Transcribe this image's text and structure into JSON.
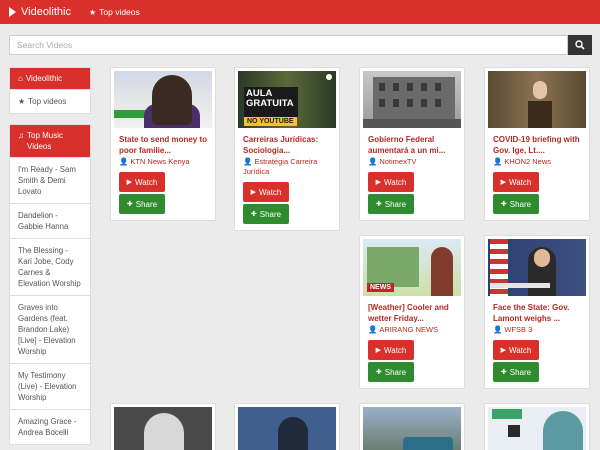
{
  "topbar": {
    "brand": "Videolithic",
    "top_videos_link": "Top videos"
  },
  "search": {
    "placeholder": "Search Videos"
  },
  "sidebar": {
    "nav_panel": {
      "home_label": "Videolithic",
      "top_videos_label": "Top videos"
    },
    "music_panel": {
      "title": "Top Music Videos",
      "items": [
        "I'm Ready - Sam Smith & Demi Lovato",
        "Dandelion - Gabbie Hanna",
        "The Blessing - Kari Jobe, Cody Carnes & Elevation Worship",
        "Graves into Gardens (feat. Brandon Lake) [Live] - Elevation Worship",
        "My Testimony (Live) - Elevation Worship",
        "Amazing Grace - Andrea Bocelli"
      ]
    }
  },
  "buttons": {
    "watch": "Watch",
    "share": "Share"
  },
  "videos": [
    {
      "title": "State to send money to poor familie...",
      "channel": "KTN News Kenya",
      "thumb_text": ""
    },
    {
      "title": "Carreiras Jurídicas: Sociologia...",
      "channel": "Estratégia Carreira Jurídica",
      "thumb_text": "AULA GRATUITA",
      "thumb_badge": "NO YOUTUBE"
    },
    {
      "title": "Gobierno Federal aumentará a un mi...",
      "channel": "NotimexTV"
    },
    {
      "title": "COVID-19 briefing with Gov. Ige, Lt....",
      "channel": "KHON2 News"
    },
    {
      "title": "[Weather] Cooler and wetter Friday...",
      "channel": "ARIRANG NEWS",
      "thumb_badge": "NEWS"
    },
    {
      "title": "Face the State: Gov. Lamont weighs ...",
      "channel": "WFSB 3"
    }
  ]
}
